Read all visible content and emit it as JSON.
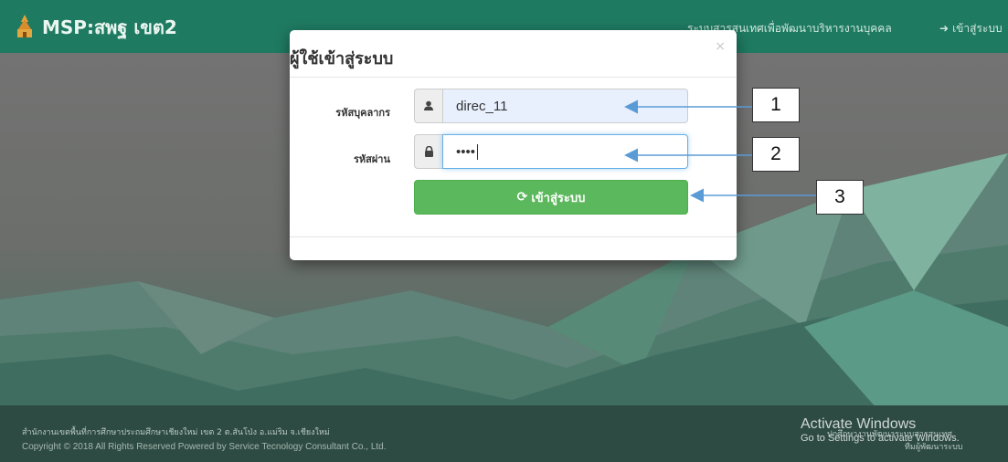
{
  "navbar": {
    "brand": "MSP:สพฐ เขต2",
    "info_link": "ระบบสารสนเทศเพื่อพัฒนาบริหารงานบุคคล",
    "login_link": "เข้าสู่ระบบ",
    "login_icon": "sign-in-icon",
    "logo_icon": "emblem-logo"
  },
  "modal": {
    "title": "ผู้ใช้เข้าสู่ระบบ",
    "close": "×",
    "username_label": "รหัสบุคลากร",
    "username_value": "direc_11",
    "username_icon": "user-icon",
    "password_label": "รหัสผ่าน",
    "password_value": "••••",
    "password_icon": "lock-icon",
    "submit_label": "เข้าสู่ระบบ",
    "submit_icon": "refresh-icon"
  },
  "annotations": [
    "1",
    "2",
    "3"
  ],
  "footer": {
    "line1": "สำนักงานเขตพื้นที่การศึกษาประถมศึกษาเชียงใหม่ เขต 2 ต.สันโป่ง อ.แม่ริม จ.เชียงใหม่",
    "line2": "Copyright © 2018 All Rights Reserved Powered by Service Tecnology Consultant Co., Ltd.",
    "right1": "ปกศึกษางานพัฒนาระบบสารสนเทศ",
    "right2": "ทีมผู้พัฒนาระบบ"
  },
  "watermark": {
    "line1": "Activate Windows",
    "line2": "Go to Settings to activate Windows."
  },
  "colors": {
    "navbar": "#1f7a62",
    "button": "#5cb85c",
    "arrow": "#5b9bd5"
  }
}
